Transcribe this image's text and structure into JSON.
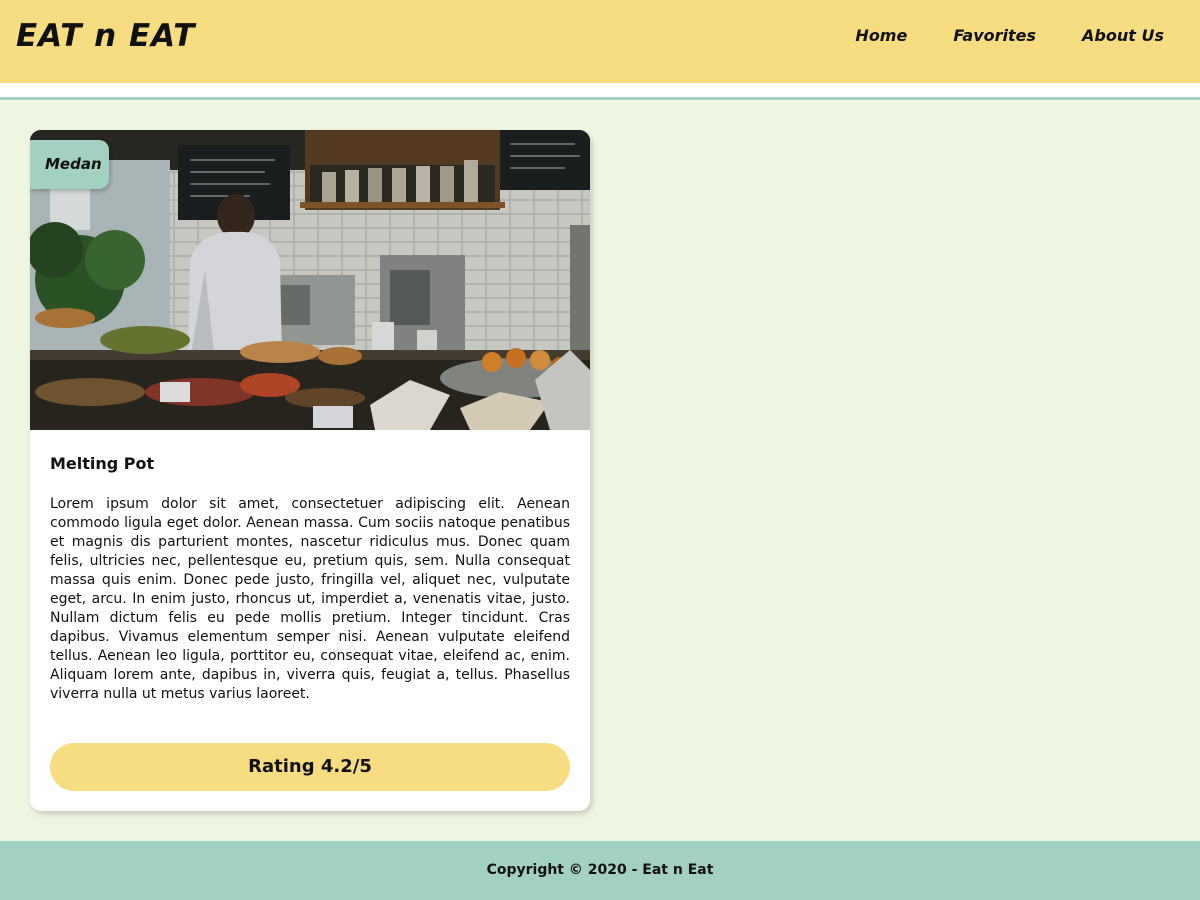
{
  "header": {
    "brand": "EAT n EAT",
    "nav": [
      {
        "label": "Home"
      },
      {
        "label": "Favorites"
      },
      {
        "label": "About Us"
      }
    ]
  },
  "colors": {
    "page_background": "#eff6e0",
    "header_background": "#f8dc82",
    "accent_teal": "#a3d1c1",
    "rating_button": "#f8dc82",
    "card_background": "#ffffff"
  },
  "restaurant_card": {
    "image_subject": "cafe-counter-photo",
    "city": "Medan",
    "name": "Melting Pot",
    "description": "Lorem ipsum dolor sit amet, consectetuer adipiscing elit. Aenean commodo ligula eget dolor. Aenean massa. Cum sociis natoque penatibus et magnis dis parturient montes, nascetur ridiculus mus. Donec quam felis, ultricies nec, pellentesque eu, pretium quis, sem. Nulla consequat massa quis enim. Donec pede justo, fringilla vel, aliquet nec, vulputate eget, arcu. In enim justo, rhoncus ut, imperdiet a, venenatis vitae, justo. Nullam dictum felis eu pede mollis pretium. Integer tincidunt. Cras dapibus. Vivamus elementum semper nisi. Aenean vulputate eleifend tellus. Aenean leo ligula, porttitor eu, consequat vitae, eleifend ac, enim. Aliquam lorem ante, dapibus in, viverra quis, feugiat a, tellus. Phasellus viverra nulla ut metus varius laoreet.",
    "rating_label": "Rating 4.2/5"
  },
  "footer": {
    "copyright": "Copyright © 2020 - Eat n Eat"
  }
}
